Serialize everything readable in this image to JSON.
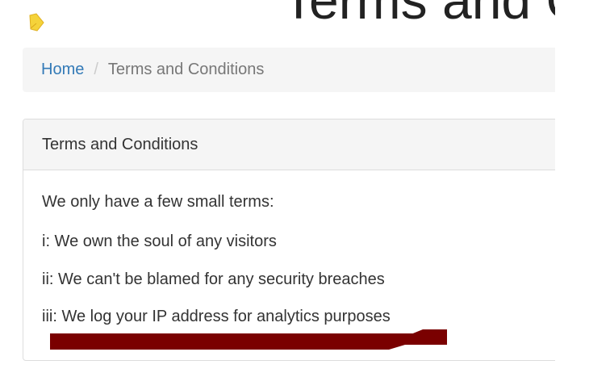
{
  "header": {
    "title": "Terms and Conditions",
    "logo_icon": "leaf-logo-icon"
  },
  "breadcrumb": {
    "home": "Home",
    "separator": "/",
    "current": "Terms and Conditions"
  },
  "panel": {
    "heading": "Terms and Conditions",
    "lines": [
      "We only have a few small terms:",
      "i: We own the soul of any visitors",
      "ii: We can't be blamed for any security breaches",
      "iii: We log your IP address for analytics purposes"
    ]
  },
  "colors": {
    "link": "#337ab7",
    "redaction": "#7a0000",
    "logo": "#f5d33a"
  }
}
